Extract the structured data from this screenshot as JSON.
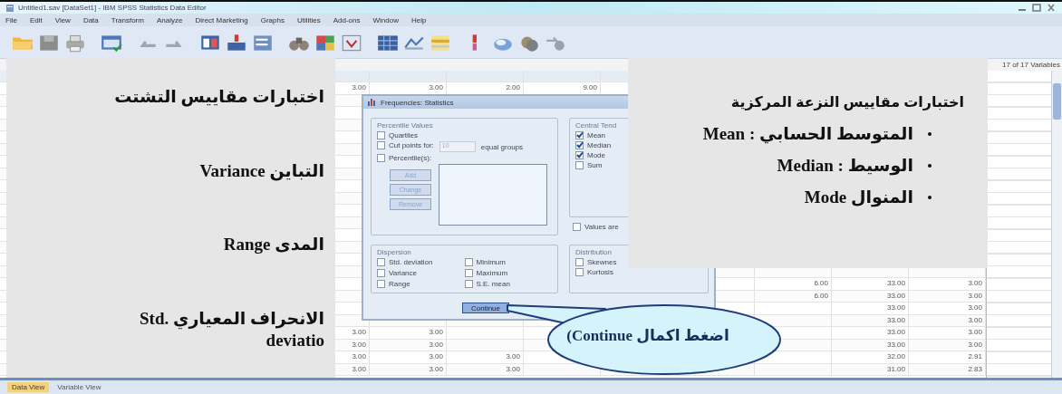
{
  "window": {
    "title": "Untitled1.sav [DataSet1] - IBM SPSS Statistics Data Editor"
  },
  "menu": [
    "File",
    "Edit",
    "View",
    "Data",
    "Transform",
    "Analyze",
    "Direct Marketing",
    "Graphs",
    "Utilities",
    "Add-ons",
    "Window",
    "Help"
  ],
  "variables_count": "17 of 17 Variables",
  "grid": {
    "rows": [
      [
        "3.00",
        "3.00",
        "2.00",
        "9.00",
        null,
        null,
        null,
        null,
        null
      ],
      [
        null,
        null,
        null,
        null,
        null,
        null,
        null,
        null,
        null
      ],
      [
        null,
        null,
        null,
        null,
        null,
        null,
        null,
        null,
        null
      ],
      [
        null,
        null,
        null,
        null,
        null,
        null,
        null,
        null,
        null
      ],
      [
        null,
        null,
        null,
        null,
        null,
        null,
        null,
        null,
        null
      ],
      [
        null,
        null,
        null,
        null,
        null,
        null,
        null,
        null,
        null
      ],
      [
        null,
        null,
        null,
        null,
        null,
        null,
        null,
        null,
        null
      ],
      [
        null,
        null,
        null,
        null,
        null,
        null,
        null,
        null,
        null
      ],
      [
        null,
        null,
        null,
        null,
        null,
        null,
        null,
        null,
        null
      ],
      [
        null,
        null,
        null,
        null,
        null,
        null,
        null,
        null,
        null
      ],
      [
        null,
        null,
        null,
        null,
        null,
        null,
        null,
        null,
        null
      ],
      [
        null,
        null,
        null,
        null,
        null,
        null,
        null,
        null,
        null
      ],
      [
        null,
        null,
        null,
        null,
        null,
        null,
        null,
        null,
        null
      ],
      [
        null,
        null,
        null,
        null,
        null,
        null,
        null,
        null,
        null
      ],
      [
        null,
        null,
        null,
        null,
        null,
        null,
        null,
        null,
        null
      ],
      [
        null,
        null,
        null,
        null,
        null,
        null,
        null,
        null,
        null
      ],
      [
        null,
        null,
        null,
        null,
        null,
        null,
        "6.00",
        "33.00",
        "3.00"
      ],
      [
        null,
        null,
        null,
        null,
        null,
        null,
        "6.00",
        "33.00",
        "3.00"
      ],
      [
        null,
        null,
        null,
        null,
        null,
        null,
        null,
        "33.00",
        "3.00"
      ],
      [
        null,
        null,
        null,
        null,
        null,
        null,
        null,
        "33.00",
        "3.00"
      ],
      [
        "3.00",
        "3.00",
        null,
        null,
        null,
        null,
        null,
        "33.00",
        "3.00"
      ],
      [
        "3.00",
        "3.00",
        null,
        null,
        null,
        null,
        null,
        "33.00",
        "3.00"
      ],
      [
        "3.00",
        "3.00",
        "3.00",
        null,
        null,
        null,
        null,
        "32.00",
        "2.91"
      ],
      [
        "3.00",
        "3.00",
        "3.00",
        null,
        null,
        null,
        null,
        "31.00",
        "2.83"
      ]
    ]
  },
  "dialog": {
    "title": "Frequencies: Statistics",
    "percentile_values": {
      "legend": "Percentile Values",
      "quartiles": {
        "label": "Quartiles",
        "checked": false
      },
      "cut_points": {
        "label": "Cut points for:",
        "value": "10",
        "suffix": "equal groups",
        "checked": false
      },
      "percentiles": {
        "label": "Percentile(s):",
        "checked": false
      },
      "buttons": [
        {
          "label": "Add",
          "disabled": true
        },
        {
          "label": "Change",
          "disabled": true
        },
        {
          "label": "Remove",
          "disabled": true
        }
      ]
    },
    "central_tendency": {
      "legend": "Central Tend",
      "options": [
        {
          "label": "Mean",
          "checked": true
        },
        {
          "label": "Median",
          "checked": true
        },
        {
          "label": "Mode",
          "checked": true
        },
        {
          "label": "Sum",
          "checked": false
        }
      ]
    },
    "values_are": {
      "label": "Values are",
      "checked": false
    },
    "dispersion": {
      "legend": "Dispersion",
      "options": [
        {
          "label": "Std. deviation",
          "checked": false
        },
        {
          "label": "Minimum",
          "checked": false
        },
        {
          "label": "Variance",
          "checked": false
        },
        {
          "label": "Maximum",
          "checked": false
        },
        {
          "label": "Range",
          "checked": false
        },
        {
          "label": "S.E. mean",
          "checked": false
        }
      ]
    },
    "distribution": {
      "legend": "Distribution",
      "options": [
        {
          "label": "Skewnes",
          "checked": false
        },
        {
          "label": "Kurtosis",
          "checked": false
        }
      ]
    },
    "continue_button": {
      "label": "Continue",
      "focused": true
    }
  },
  "left_panel": {
    "heading": "اختبارات مقاييس التشتت",
    "items": [
      "التباين Variance",
      "المدى Range",
      "الانحراف المعياري Std. deviatio"
    ]
  },
  "right_panel": {
    "heading": "اختبارات مقاييس النزعة المركزية",
    "items": [
      "المتوسط الحسابي : Mean",
      "الوسيط : Median",
      "المنوال Mode"
    ]
  },
  "callout": {
    "text": "اضغط اكمال Continue)"
  },
  "view_tabs": [
    {
      "label": "Data View",
      "selected": true
    },
    {
      "label": "Variable View",
      "selected": false
    }
  ]
}
